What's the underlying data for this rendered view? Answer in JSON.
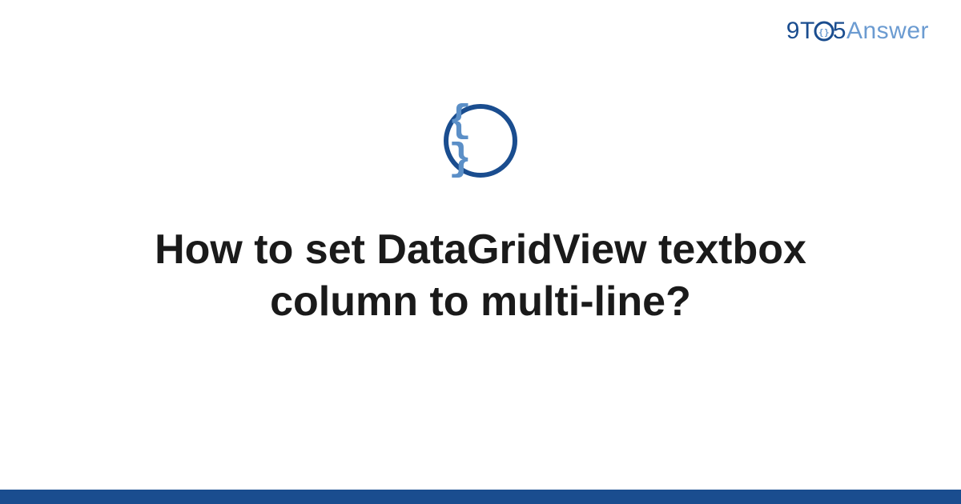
{
  "logo": {
    "nine": "9",
    "t": "T",
    "five": "5",
    "answer": "Answer"
  },
  "icon": {
    "braces": "{ }"
  },
  "title": "How to set DataGridView textbox column to multi-line?",
  "colors": {
    "primary": "#1a4d8f",
    "secondary": "#6b9bd1",
    "braces": "#5b8fc7"
  }
}
